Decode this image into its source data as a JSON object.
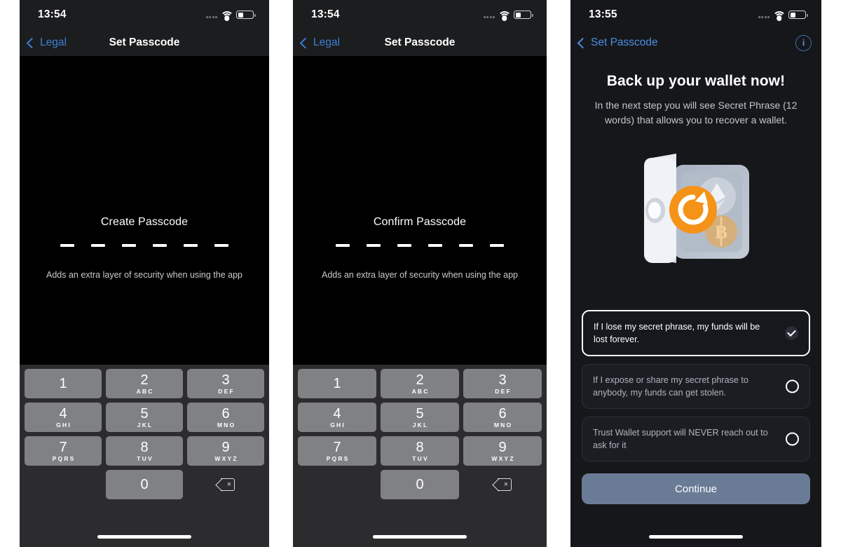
{
  "panels": [
    {
      "status": {
        "time": "13:54",
        "wifi_icon": "wifi-icon",
        "battery_icon": "battery-icon",
        "signal_icon": "signal-dots-icon"
      },
      "nav": {
        "back_label": "Legal",
        "title": "Set Passcode",
        "back_icon": "chevron-left-icon"
      },
      "passcode": {
        "title": "Create Passcode",
        "subtitle": "Adds an extra layer of security when using the app",
        "slots": 6
      },
      "keypad": {
        "keys": [
          {
            "num": "1",
            "letters": ""
          },
          {
            "num": "2",
            "letters": "ABC"
          },
          {
            "num": "3",
            "letters": "DEF"
          },
          {
            "num": "4",
            "letters": "GHI"
          },
          {
            "num": "5",
            "letters": "JKL"
          },
          {
            "num": "6",
            "letters": "MNO"
          },
          {
            "num": "7",
            "letters": "PQRS"
          },
          {
            "num": "8",
            "letters": "TUV"
          },
          {
            "num": "9",
            "letters": "WXYZ"
          },
          {
            "num": "0",
            "letters": ""
          }
        ],
        "delete_icon": "backspace-icon",
        "delete_glyph": "×"
      }
    },
    {
      "status": {
        "time": "13:54",
        "wifi_icon": "wifi-icon",
        "battery_icon": "battery-icon",
        "signal_icon": "signal-dots-icon"
      },
      "nav": {
        "back_label": "Legal",
        "title": "Set Passcode",
        "back_icon": "chevron-left-icon"
      },
      "passcode": {
        "title": "Confirm Passcode",
        "subtitle": "Adds an extra layer of security when using the app",
        "slots": 6
      },
      "keypad": {
        "keys": [
          {
            "num": "1",
            "letters": ""
          },
          {
            "num": "2",
            "letters": "ABC"
          },
          {
            "num": "3",
            "letters": "DEF"
          },
          {
            "num": "4",
            "letters": "GHI"
          },
          {
            "num": "5",
            "letters": "JKL"
          },
          {
            "num": "6",
            "letters": "MNO"
          },
          {
            "num": "7",
            "letters": "PQRS"
          },
          {
            "num": "8",
            "letters": "TUV"
          },
          {
            "num": "9",
            "letters": "WXYZ"
          },
          {
            "num": "0",
            "letters": ""
          }
        ],
        "delete_icon": "backspace-icon",
        "delete_glyph": "×"
      }
    }
  ],
  "backup": {
    "status": {
      "time": "13:55",
      "wifi_icon": "wifi-icon",
      "battery_icon": "battery-icon",
      "signal_icon": "signal-dots-icon"
    },
    "nav": {
      "back_label": "Set Passcode",
      "title": "",
      "back_icon": "chevron-left-icon",
      "info_icon": "info-circle-icon",
      "info_glyph": "i"
    },
    "heading": "Back up your wallet now!",
    "subheading": "In the next step you will see Secret Phrase (12 words) that allows you to recover a wallet.",
    "illustration": {
      "name": "wallet-safe-restore-illustration",
      "badge_icon": "refresh-circle-icon",
      "coin_eth_icon": "ethereum-coin-icon",
      "coin_btc_icon": "bitcoin-coin-icon",
      "accent_color": "#f59218"
    },
    "acknowledgements": [
      {
        "text": "If I lose my secret phrase, my funds will be lost forever.",
        "checked": true
      },
      {
        "text": "If I expose or share my secret phrase to anybody, my funds can get stolen.",
        "checked": false
      },
      {
        "text": "Trust Wallet support will NEVER reach out to ask for it",
        "checked": false
      }
    ],
    "continue_label": "Continue",
    "continue_color": "#6a7b95"
  }
}
